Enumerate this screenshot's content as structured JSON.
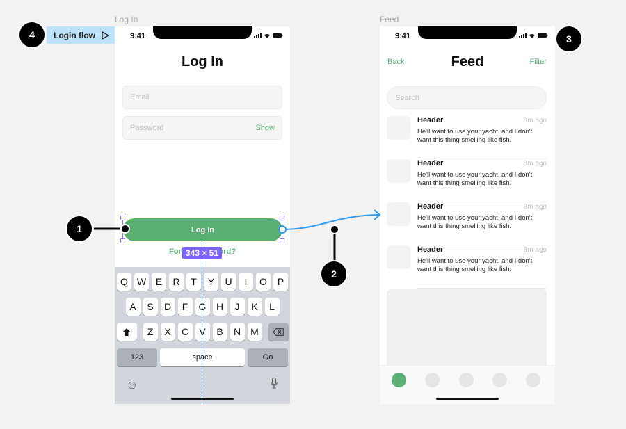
{
  "frames": {
    "login_label": "Log In",
    "feed_label": "Feed"
  },
  "flow": {
    "label": "Login flow",
    "play_icon": "play-triangle-icon"
  },
  "annotations": [
    "1",
    "2",
    "3",
    "4"
  ],
  "selection": {
    "dimension_label": "343 × 51"
  },
  "login": {
    "status_time": "9:41",
    "title": "Log In",
    "email_placeholder": "Email",
    "password_placeholder": "Password",
    "show_label": "Show",
    "login_button": "Log In",
    "forgot_label": "Forgot password?",
    "keyboard": {
      "row1": [
        "Q",
        "W",
        "E",
        "R",
        "T",
        "Y",
        "U",
        "I",
        "O",
        "P"
      ],
      "row2": [
        "A",
        "S",
        "D",
        "F",
        "G",
        "H",
        "J",
        "K",
        "L"
      ],
      "row3": [
        "Z",
        "X",
        "C",
        "V",
        "B",
        "N",
        "M"
      ],
      "shift_icon": "shift-arrow-icon",
      "delete_icon": "backspace-icon",
      "numbers_key": "123",
      "space_key": "space",
      "go_key": "Go",
      "emoji_icon": "emoji-icon",
      "mic_icon": "microphone-icon"
    }
  },
  "feed": {
    "status_time": "9:41",
    "back_label": "Back",
    "title": "Feed",
    "filter_label": "Filter",
    "search_placeholder": "Search",
    "items": [
      {
        "header": "Header",
        "time": "8m ago",
        "body": "He'll want to use your yacht, and I don't want this thing smelling like fish."
      },
      {
        "header": "Header",
        "time": "8m ago",
        "body": "He'll want to use your yacht, and I don't want this thing smelling like fish."
      },
      {
        "header": "Header",
        "time": "8m ago",
        "body": "He'll want to use your yacht, and I don't want this thing smelling like fish."
      },
      {
        "header": "Header",
        "time": "8m ago",
        "body": "He'll want to use your yacht, and I don't want this thing smelling like fish."
      }
    ],
    "tabs": [
      {
        "name": "tab-1",
        "active": true
      },
      {
        "name": "tab-2",
        "active": false
      },
      {
        "name": "tab-3",
        "active": false
      },
      {
        "name": "tab-4",
        "active": false
      },
      {
        "name": "tab-5",
        "active": false
      }
    ]
  },
  "colors": {
    "accent_green": "#5aaf73",
    "selection_purple": "#7b61ff",
    "connector_blue": "#2f9cf0",
    "flow_tag_bg": "#bde3fc"
  }
}
